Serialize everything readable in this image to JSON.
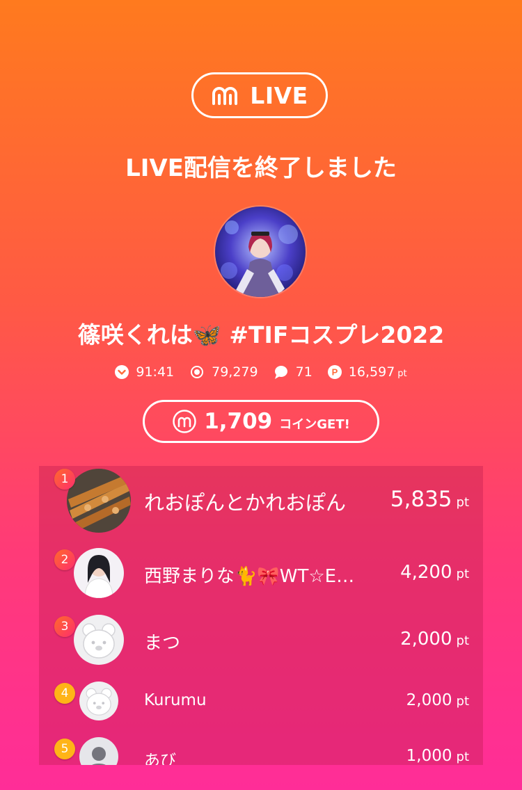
{
  "header": {
    "logo_text": "LIVE",
    "end_message": "LIVE配信を終了しました"
  },
  "broadcaster": {
    "name": "篠咲くれは🦋 #TIFコスプレ2022"
  },
  "stats": {
    "duration": "91:41",
    "viewers": "79,279",
    "comments": "71",
    "points": "16,597",
    "points_unit": "pt"
  },
  "coins": {
    "amount": "1,709",
    "label": "コインGET!"
  },
  "ranking": [
    {
      "rank": "1",
      "name": "れおぽんとかれおぽん",
      "points": "5,835",
      "unit": "pt"
    },
    {
      "rank": "2",
      "name": "西野まりな🐈🎀WT☆E…",
      "points": "4,200",
      "unit": "pt"
    },
    {
      "rank": "3",
      "name": "まつ",
      "points": "2,000",
      "unit": "pt"
    },
    {
      "rank": "4",
      "name": "Kurumu",
      "points": "2,000",
      "unit": "pt"
    },
    {
      "rank": "5",
      "name": "あび",
      "points": "1,000",
      "unit": "pt"
    }
  ],
  "icons": {
    "logo": "m-logo-icon",
    "duration": "chevron-down-circle-icon",
    "viewers": "viewers-icon",
    "comments": "comment-bubble-icon",
    "points": "p-coin-icon",
    "coin": "m-coin-icon"
  },
  "colors": {
    "top_gradient": "#ff7a1e",
    "bottom_gradient": "#ff2d98",
    "rank_top": "#ff2d6e",
    "rank_mid": "#ffb417"
  }
}
